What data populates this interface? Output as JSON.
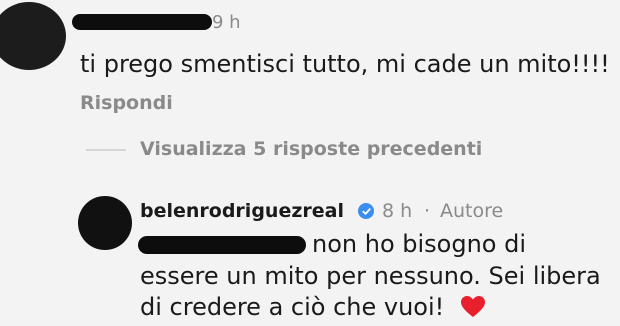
{
  "comment": {
    "time": "9 h",
    "text": "ti prego smentisci tutto, mi cade un mito!!!!",
    "reply_label": "Rispondi"
  },
  "replies_toggle": {
    "label": "Visualizza 5 risposte precedenti"
  },
  "reply": {
    "username": "belenrodriguezreal",
    "time": "8 h",
    "separator": "·",
    "author_tag": "Autore",
    "line1": "non ho bisogno di",
    "line2": "essere un mito per nessuno. Sei libera",
    "line3": "di credere a ciò che vuoi!",
    "heart_color": "#e8202e",
    "verified_color": "#3b8ef0"
  }
}
